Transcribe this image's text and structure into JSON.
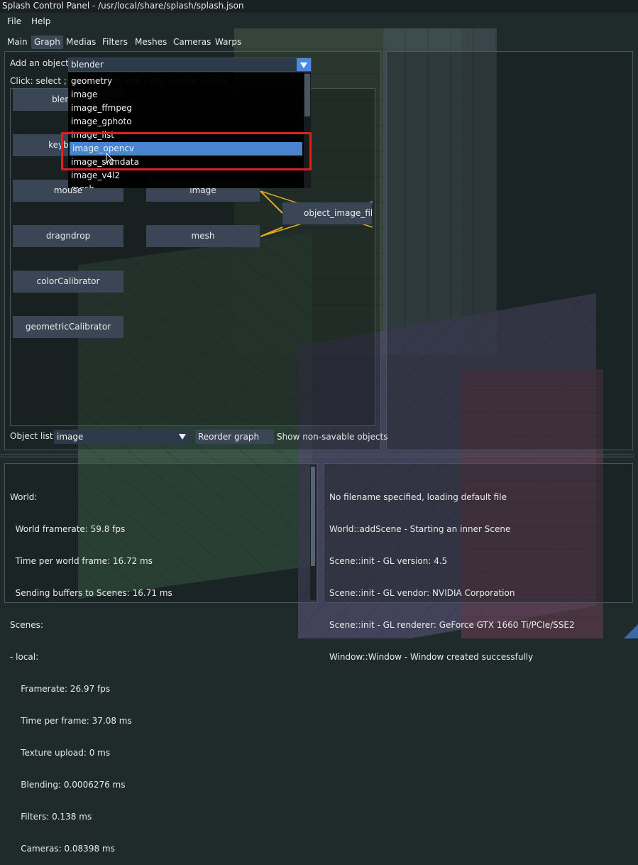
{
  "window": {
    "title": "Splash Control Panel - /usr/local/share/splash/splash.json"
  },
  "menu": {
    "file": "File",
    "help": "Help"
  },
  "tabs": [
    "Main",
    "Graph",
    "Medias",
    "Filters",
    "Meshes",
    "Cameras",
    "Warps"
  ],
  "active_tab": "Graph",
  "graph": {
    "add_object_label": "Add an object:",
    "add_object_value": "blender",
    "help_text": "Click: select ; Shift + click: link ; Ctrl + click: unlink",
    "dropdown_items": [
      "geometry",
      "image",
      "image_ffmpeg",
      "image_gphoto",
      "image_list",
      "image_opencv",
      "image_shmdata",
      "image_v4l2",
      "mesh"
    ],
    "dropdown_selected": "image_opencv",
    "nodes": {
      "blender": "blender",
      "keyboard": "keyboard",
      "mouse": "mouse",
      "image": "image",
      "dragndrop": "dragndrop",
      "mesh": "mesh",
      "colorCalibrator": "colorCalibrator",
      "geometricCalibrator": "geometricCalibrator",
      "object_image_filter": "object_image_filter"
    },
    "link_color": "#e0b020",
    "highlight_color": "#e01e1e",
    "object_list_label": "Object list:",
    "object_list_value": "image",
    "reorder_button": "Reorder graph",
    "show_nonsavable_label": "Show non-savable objects"
  },
  "stats": {
    "lines": [
      "World:",
      "  World framerate: 59.8 fps",
      "  Time per world frame: 16.72 ms",
      "  Sending buffers to Scenes: 16.71 ms",
      "Scenes:",
      "- local:",
      "    Framerate: 26.97 fps",
      "    Time per frame: 37.08 ms",
      "    Texture upload: 0 ms",
      "    Blending: 0.0006276 ms",
      "    Filters: 0.138 ms",
      "    Cameras: 0.08398 ms"
    ]
  },
  "log": {
    "lines": [
      "No filename specified, loading default file",
      "World::addScene - Starting an inner Scene",
      "Scene::init - GL version: 4.5",
      "Scene::init - GL vendor: NVIDIA Corporation",
      "Scene::init - GL renderer: GeForce GTX 1660 Ti/PCIe/SSE2",
      "Window::Window - Window created successfully"
    ]
  }
}
